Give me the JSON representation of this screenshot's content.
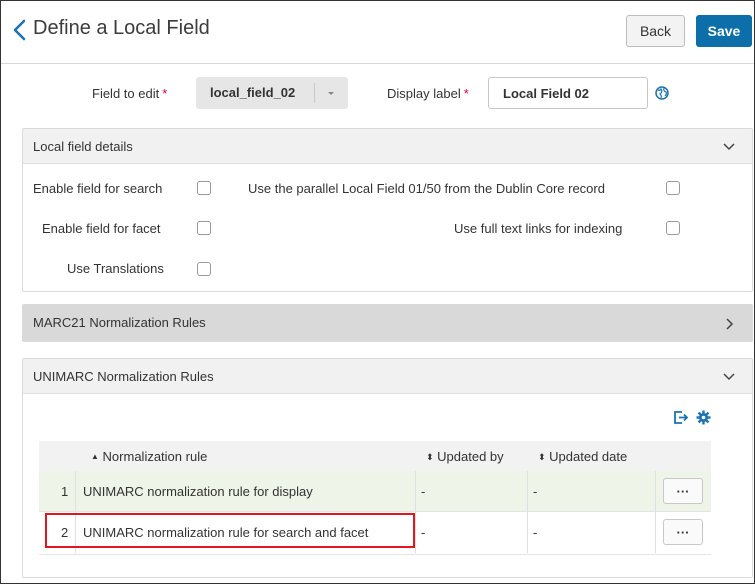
{
  "header": {
    "title": "Define a Local Field",
    "back_label": "Back",
    "save_label": "Save"
  },
  "field_row": {
    "field_to_edit_label": "Field to edit",
    "field_to_edit_value": "local_field_02",
    "display_label_label": "Display label",
    "display_label_value": "Local Field 02",
    "required_mark": "*"
  },
  "local_field_details": {
    "title": "Local field details",
    "enable_search": "Enable field for search",
    "enable_facet": "Enable field for facet",
    "use_translations": "Use Translations",
    "use_parallel": "Use the parallel Local Field 01/50 from the Dublin Core record",
    "use_full_text": "Use full text links for indexing"
  },
  "marc21": {
    "title": "MARC21 Normalization Rules"
  },
  "unimarc": {
    "title": "UNIMARC Normalization Rules",
    "columns": {
      "rule": "Normalization rule",
      "updated_by": "Updated by",
      "updated_date": "Updated date"
    },
    "rows": [
      {
        "num": "1",
        "rule": "UNIMARC normalization rule for display",
        "updated_by": "-",
        "updated_date": "-",
        "actions": "···"
      },
      {
        "num": "2",
        "rule": "UNIMARC normalization rule for search and facet",
        "updated_by": "-",
        "updated_date": "-",
        "actions": "···"
      }
    ]
  },
  "colors": {
    "accent": "#0d6fa9",
    "required": "#d9003a",
    "highlight": "#e0181e",
    "row_selected": "#eef4e8"
  },
  "icons": [
    "chevron-left-icon",
    "caret-down-icon",
    "globe-icon",
    "chevron-down-icon",
    "chevron-right-icon",
    "export-icon",
    "gear-icon",
    "sort-icon"
  ]
}
